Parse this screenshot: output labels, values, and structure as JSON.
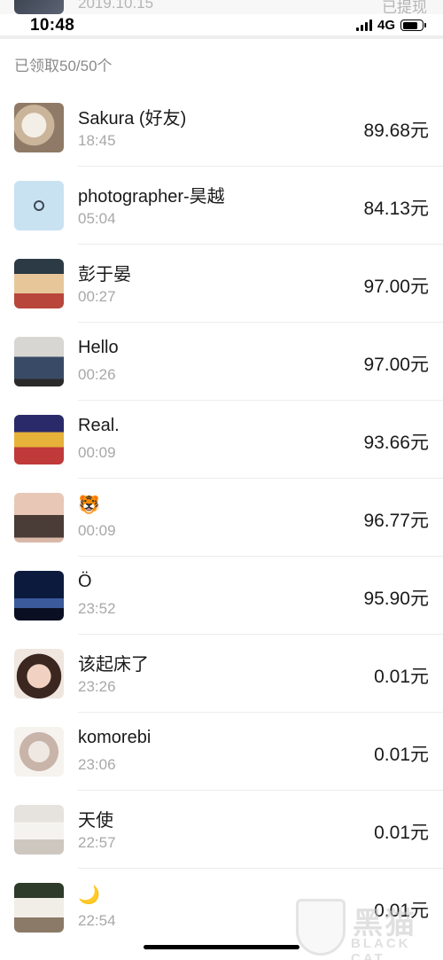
{
  "previous_row": {
    "date": "2019.10.15",
    "status": "已提现"
  },
  "status_bar": {
    "time": "10:48",
    "network": "4G"
  },
  "summary": "已领取50/50个",
  "records": [
    {
      "name": "Sakura (好友)",
      "time": "18:45",
      "amount": "89.68元",
      "avatar": "cat-avatar"
    },
    {
      "name": "photographer-昊越",
      "time": "05:04",
      "amount": "84.13元",
      "avatar": "blue-ring-avatar"
    },
    {
      "name": "彭于晏",
      "time": "00:27",
      "amount": "97.00元",
      "avatar": "cartoon-avatar"
    },
    {
      "name": "Hello",
      "time": "00:26",
      "amount": "97.00元",
      "avatar": "person-photo-avatar"
    },
    {
      "name": "Real.",
      "time": "00:09",
      "amount": "93.66元",
      "avatar": "yellow-shirt-avatar"
    },
    {
      "name": "🐯",
      "time": "00:09",
      "amount": "96.77元",
      "avatar": "warrior-avatar"
    },
    {
      "name": "Ö",
      "time": "23:52",
      "amount": "95.90元",
      "avatar": "night-sky-avatar"
    },
    {
      "name": "该起床了",
      "time": "23:26",
      "amount": "0.01元",
      "avatar": "girl-photo-avatar"
    },
    {
      "name": "komorebi",
      "time": "23:06",
      "amount": "0.01元",
      "avatar": "baby-photo-avatar"
    },
    {
      "name": "天使",
      "time": "22:57",
      "amount": "0.01元",
      "avatar": "sitting-girl-avatar"
    },
    {
      "name": "🌙",
      "time": "22:54",
      "amount": "0.01元",
      "avatar": "portrait-avatar"
    }
  ],
  "watermark": {
    "cn": "黑猫",
    "en": "BLACK CAT"
  }
}
